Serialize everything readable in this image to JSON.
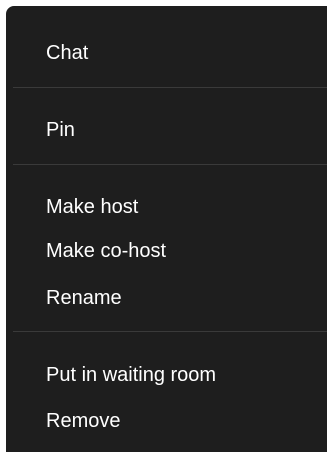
{
  "context_menu": {
    "background": "#1e1e1e",
    "divider_color": "#3a3a3a",
    "items": [
      {
        "label": "Chat"
      },
      {
        "label": "Pin"
      },
      {
        "label": "Make host"
      },
      {
        "label": "Make co-host"
      },
      {
        "label": "Rename"
      },
      {
        "label": "Put in waiting room"
      },
      {
        "label": "Remove"
      }
    ]
  }
}
